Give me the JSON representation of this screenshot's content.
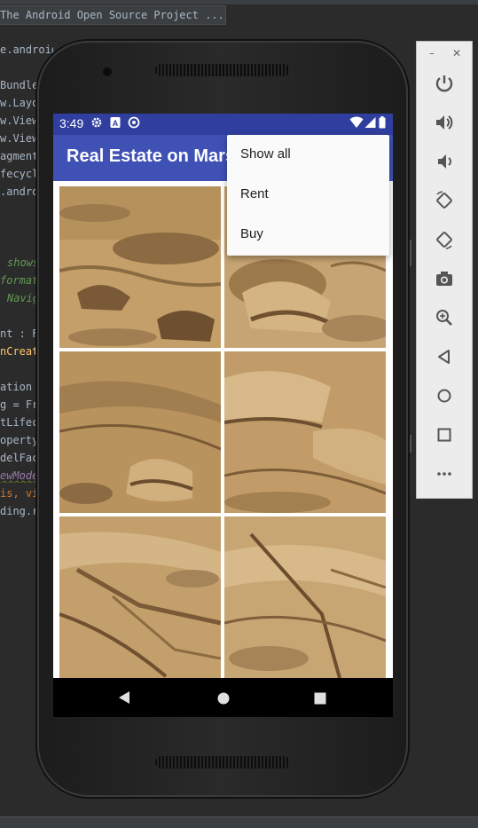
{
  "ide": {
    "tab_title": "The Android Open Source Project .../",
    "code_lines": [
      {
        "text": "e.android",
        "cls": ""
      },
      {
        "text": "Bundle",
        "cls": ""
      },
      {
        "text": "w.Layo",
        "cls": ""
      },
      {
        "text": "w.View",
        "cls": ""
      },
      {
        "text": "w.View",
        "cls": ""
      },
      {
        "text": "agment",
        "cls": ""
      },
      {
        "text": "fecycl",
        "cls": ""
      },
      {
        "text": ".andro",
        "cls": ""
      },
      {
        "text": "shows",
        "cls": "code-comment"
      },
      {
        "text": "format",
        "cls": "code-comment"
      },
      {
        "text": "Navig",
        "cls": "code-comment"
      },
      {
        "text": "nt : F",
        "cls": ""
      },
      {
        "text": "nCreat",
        "cls": "code-func"
      },
      {
        "text": "ation",
        "cls": ""
      },
      {
        "text": "g = Fr",
        "cls": ""
      },
      {
        "text": "tLifec",
        "cls": ""
      },
      {
        "text": "operty",
        "cls": ""
      },
      {
        "text": "delFac",
        "cls": ""
      },
      {
        "text": "ewMode",
        "cls": "code-purple"
      },
      {
        "text": "is, vi",
        "cls": "code-key"
      },
      {
        "text": "ding.r",
        "cls": ""
      }
    ]
  },
  "status_bar": {
    "time": "3:49",
    "icons": [
      "settings-icon",
      "a-icon",
      "sync-icon",
      "wifi-icon",
      "signal-icon",
      "battery-icon"
    ]
  },
  "app_bar": {
    "title": "Real Estate on Mars"
  },
  "overflow_menu": {
    "items": [
      "Show all",
      "Rent",
      "Buy"
    ]
  },
  "photo_grid": {
    "tiles": [
      "mars-photo-1",
      "mars-photo-2",
      "mars-photo-3",
      "mars-photo-4",
      "mars-photo-5",
      "mars-photo-6"
    ]
  },
  "nav_bar": {
    "buttons": [
      "back-icon",
      "home-icon",
      "recents-icon"
    ]
  },
  "emulator_panel": {
    "window_controls": [
      "minimize-icon",
      "close-icon"
    ],
    "buttons": [
      "power-icon",
      "volume-up-icon",
      "volume-down-icon",
      "rotate-left-icon",
      "rotate-right-icon",
      "camera-icon",
      "zoom-icon",
      "back-icon",
      "home-icon",
      "overview-icon",
      "more-icon"
    ]
  },
  "colors": {
    "status_bar": "#303f9f",
    "app_bar": "#3f51b5",
    "menu_bg": "#fafafa",
    "mars_sand": "#b9935e"
  }
}
